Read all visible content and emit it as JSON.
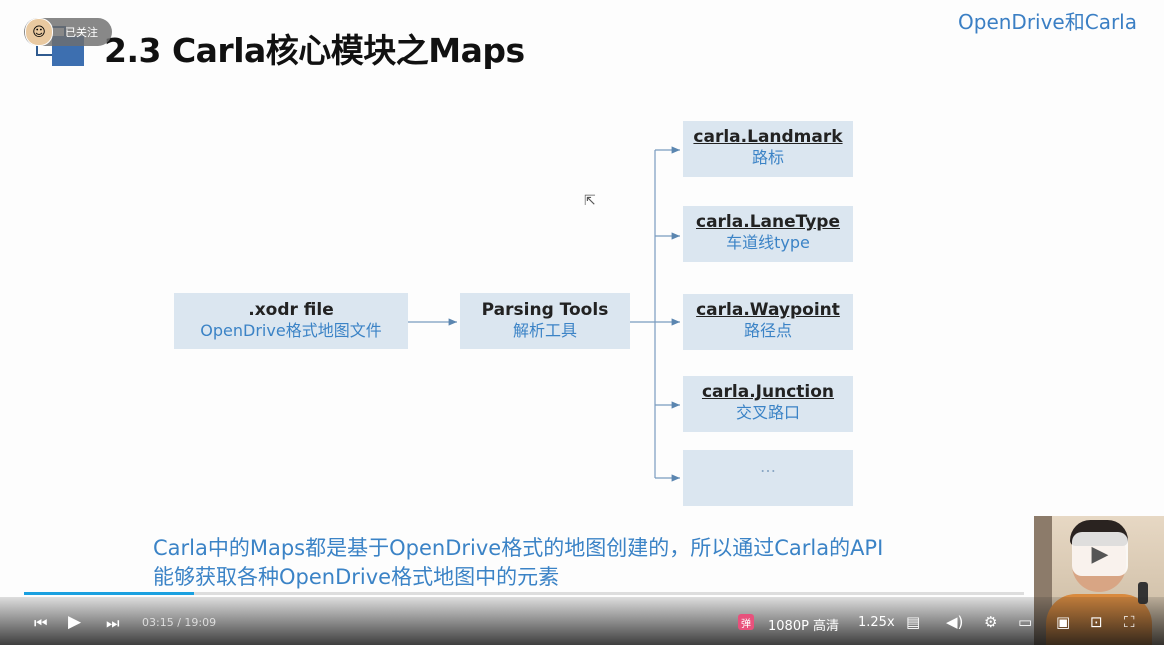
{
  "slide": {
    "title": "2.3 Carla核心模块之Maps",
    "brand": "OpenDrive和Carla",
    "follow_label": "已关注",
    "source_box": {
      "line1": ".xodr file",
      "line2": "OpenDrive格式地图文件"
    },
    "parser_box": {
      "line1": "Parsing Tools",
      "line2": "解析工具"
    },
    "targets": [
      {
        "line1": "carla.Landmark",
        "line2": "路标"
      },
      {
        "line1": "carla.LaneType",
        "line2": "车道线type"
      },
      {
        "line1": "carla.Waypoint",
        "line2": "路径点"
      },
      {
        "line1": "carla.Junction",
        "line2": "交叉路口"
      },
      {
        "line1": "",
        "line2": "…"
      }
    ],
    "caption_line1": "Carla中的Maps都是基于OpenDrive格式的地图创建的，所以通过Carla的API",
    "caption_line2": "能够获取各种OpenDrive格式地图中的元素"
  },
  "player": {
    "time": "03:15 / 19:09",
    "progress": 0.17,
    "quality": "1080P 高清",
    "speed": "1.25x",
    "danmu_icon_label": "弹",
    "icons": [
      "prev-icon",
      "play-icon",
      "next-icon",
      "danmu-toggle-icon",
      "subtitle-icon",
      "volume-icon",
      "settings-icon",
      "pip-icon",
      "widescreen-icon",
      "webfullscreen-icon",
      "fullscreen-icon"
    ],
    "accent": "#1aa0e0"
  }
}
